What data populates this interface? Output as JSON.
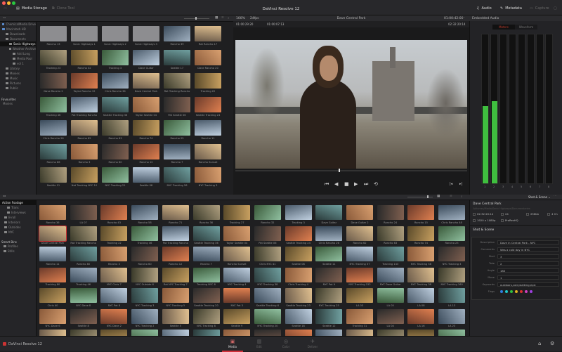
{
  "app": {
    "title": "DaVinci Resolve 12"
  },
  "toolbar": {
    "media_storage": "Media Storage",
    "clone_tool": "Clone Tool",
    "audio": "Audio",
    "metadata": "Metadata",
    "capture": "Capture"
  },
  "browser_bar": {
    "zoom": "100%",
    "fps": "24fps"
  },
  "storage_tree": [
    {
      "label": "ChemicalMedia Drive",
      "level": 0
    },
    {
      "label": "Macintosh HD",
      "level": 0
    },
    {
      "label": "Downloads",
      "level": 1
    },
    {
      "label": "Documents",
      "level": 1
    },
    {
      "label": "Sonic Highways",
      "level": 2,
      "selected": true
    },
    {
      "label": "Weather Archive",
      "level": 2
    },
    {
      "label": "Add Long",
      "level": 3
    },
    {
      "label": "Media Pool",
      "level": 3
    },
    {
      "label": "vol 1",
      "level": 3
    },
    {
      "label": "Library",
      "level": 1
    },
    {
      "label": "Movies",
      "level": 1
    },
    {
      "label": "Music",
      "level": 1
    },
    {
      "label": "Pictures",
      "level": 1
    },
    {
      "label": "Public",
      "level": 1
    }
  ],
  "favourites": {
    "heading": "Favourites",
    "items": [
      "Movies"
    ]
  },
  "storage_clips": [
    "Rancho 13",
    "Sonic Highways 1",
    "Sonic Highways 2",
    "Sonic Highways 3",
    "Rancho 39",
    "Rat Rancho 17",
    "Tracking 23",
    "Rancho 32",
    "Tracking 3",
    "Dave Guitar",
    "Seattle 17",
    "Dave Rancho 20",
    "Dave Rancho 2",
    "Taylor Rancho 19",
    "Chris Rancho 36",
    "Dave Central Park",
    "Rat Tracking Rancho",
    "Tracking 22",
    "Tracking 46",
    "Pat Tracking Rancho",
    "Seattle Tracking 36",
    "Taylor Seattle 04",
    "Pat Seattle 06",
    "Seattle Tracking 24",
    "Chris Rancho 26",
    "Rancho 62",
    "Rancho 63",
    "Rancho 74",
    "Rancho 25",
    "Rancho 11",
    "Rancho 86",
    "Rancho 3",
    "Rancho 60",
    "Rancho 12",
    "Rancho 7",
    "Rancho Sunset",
    "Seattle 11",
    "Nat Tracking NYC 10",
    "NYC Tracking 21",
    "Seattle 08",
    "NYC Tracking 58",
    "NYC Tracking 3"
  ],
  "viewer": {
    "clip_name": "Dave Central Park",
    "duration": "01:00:42:00",
    "timecode_in": "01:00:29:20",
    "timecode_out": "01:00:07:13",
    "timecode_total": "02:32:20:14"
  },
  "audio_panel": {
    "title": "Embedded Audio",
    "tabs": [
      "Meters",
      "Waveform"
    ],
    "active_tab": "Meters",
    "meter_levels": [
      0.52,
      0.55,
      0,
      0,
      0,
      0,
      0,
      0
    ],
    "active_color": "#c0392b",
    "meter_color": "#3fbf3f"
  },
  "pool_bins": {
    "root": "Action Footage",
    "items": [
      "Trans",
      "Interviews",
      "B-roll",
      "Interiors",
      "Outsides",
      "NYC"
    ],
    "smart_heading": "Smart Bins",
    "smart_items": [
      "Profiles",
      "Stills"
    ]
  },
  "pool_clips": [
    "Rancho 36",
    "LA 07",
    "Rancho 43",
    "Rancho 58",
    "Rancho 71",
    "Rancho 36",
    "Tracking 27",
    "Rancho 32",
    "Tracking 3",
    "Dave Guitar",
    "Dave Guitar 2",
    "Rancho 24",
    "Rancho 15",
    "Chris Rancho 48",
    "Dave Central Park",
    "Rat Tracking Rancho",
    "Tracking 22",
    "Tracking 46",
    "Pat Tracking Rancho",
    "Seattle Tracking 36",
    "Taylor Seattle 04",
    "Pat Seattle 06",
    "Seattle Tracking 24",
    "Chris Rancho 26",
    "Rancho 62",
    "Rancho 63",
    "Rancho 74",
    "Rancho 25",
    "Rancho 11",
    "Rancho 80",
    "Rancho 3",
    "Rancho 60",
    "Rancho 12",
    "Rancho 7",
    "Rancho Sunset",
    "Chris NYC 41",
    "Seattle 08",
    "Seattle 11",
    "NYC Tracking 37",
    "Tracking 143",
    "NYC Tracking 58",
    "NYC Tracking 3",
    "Tracking 80",
    "Tracking 46",
    "NYC Chris 7",
    "NYC Outside 6",
    "Rat NYC Tracking 7",
    "Tracking NYC 8",
    "NYC Tracking 4",
    "NYC Tracking 38",
    "Chris Tracking 4",
    "NYC Pat 9",
    "NYC Tracking 152",
    "NYC Dave Guitar",
    "NYC Tracking 38",
    "NYC Tracking 160",
    "Chris 40",
    "NYC Dave 8",
    "NYC Pat 8",
    "NYC Tracking 3",
    "NYC Tracking 5",
    "Seattle Tracking 20",
    "NYC Pat 3",
    "Seattle Tracking 6",
    "Seattle Tracking 23",
    "NYC Tracking 25",
    "LA 03",
    "LA 05",
    "LA 08",
    "LA 13",
    "NYC Dave 6",
    "Seattle 8",
    "NYC Dave 2",
    "NYC Tracking 2",
    "Seattle 5",
    "NYC Tracking 8",
    "Seattle 9",
    "NYC Tracking 20",
    "Seattle 18",
    "Seattle 12",
    "Tracking 31",
    "LA 04",
    "LA 16",
    "LA 23",
    "Seattle Tracking 19",
    "NYC Tracking 9",
    "Seattle 3",
    "NYC Tracking 11",
    "Seattle 4",
    "NYC Tracking 12",
    "Seattle 6",
    "NYC Tracking 14",
    "Seattle 7",
    "NYC Tracking 15",
    "Seattle 10",
    "LA 09",
    "LA 10",
    "LA 11"
  ],
  "metadata": {
    "panel_select": "Shot & Scene",
    "clip_name": "Dave Central Park",
    "path": "/Volumes/Media/Sonic Highways/Documentaries",
    "info": [
      "02:32:20:14",
      "24",
      "256kb",
      "4 Ch",
      "1920 x 1080p",
      "ProResHQ"
    ],
    "section": "Shot & Scene",
    "fields": [
      {
        "label": "Description",
        "value": "Dave in Central Park - NYC"
      },
      {
        "label": "Comments",
        "value": "Was a cold day in NYC"
      },
      {
        "label": "Shot",
        "value": "3"
      },
      {
        "label": "Take",
        "value": "2"
      },
      {
        "label": "Angle",
        "value": "180"
      },
      {
        "label": "Move",
        "value": "1"
      },
      {
        "label": "Keywords",
        "value": "outdoors,cold,walking,epic"
      }
    ],
    "flags_label": "Flags",
    "flag_colors": [
      "#2f7fe0",
      "#1fc7c7",
      "#2fbf3f",
      "#e0b020",
      "#d8302f",
      "#d040c0",
      "#a040e0"
    ]
  },
  "footer": {
    "app": "DaVinci Resolve 12",
    "tabs": [
      {
        "label": "Media",
        "icon": "media-icon"
      },
      {
        "label": "Edit",
        "icon": "edit-icon"
      },
      {
        "label": "Color",
        "icon": "color-icon"
      },
      {
        "label": "Deliver",
        "icon": "deliver-icon"
      }
    ],
    "active_tab": "Media",
    "accent": "#d0303a"
  }
}
